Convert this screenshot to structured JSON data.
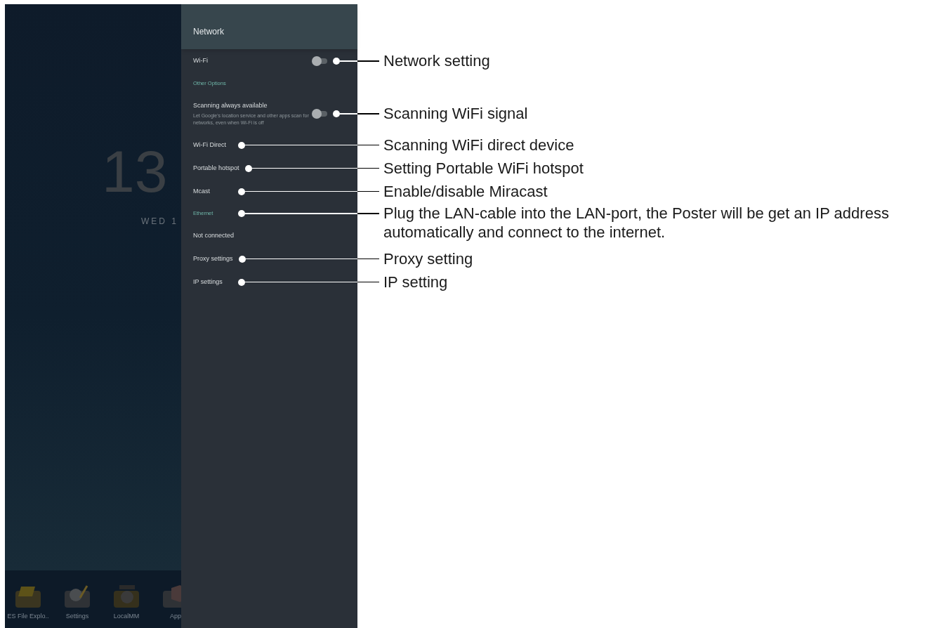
{
  "home_screen": {
    "clock": "13",
    "date": "WED 1",
    "dock": [
      {
        "label": "ES File Explo.."
      },
      {
        "label": "Settings"
      },
      {
        "label": "LocalMM"
      },
      {
        "label": "App"
      }
    ]
  },
  "panel": {
    "title": "Network",
    "items": [
      {
        "kind": "toggle",
        "label": "Wi-Fi",
        "on": false,
        "callout": "Network setting"
      },
      {
        "kind": "header",
        "label": "Other Options"
      },
      {
        "kind": "toggle",
        "label": "Scanning always available",
        "subtitle": "Let Google's location service and other apps scan for networks, even when Wi-Fi is off",
        "on": false,
        "callout": "Scanning WiFi signal"
      },
      {
        "kind": "item",
        "label": "Wi-Fi Direct",
        "callout": "Scanning WiFi direct device"
      },
      {
        "kind": "item",
        "label": "Portable hotspot",
        "callout": "Setting Portable WiFi hotspot"
      },
      {
        "kind": "item",
        "label": "Mcast",
        "callout": "Enable/disable Miracast"
      },
      {
        "kind": "header",
        "label": "Ethernet",
        "callout": "Plug the LAN-cable into the LAN-port, the Poster will be get an IP address automatically and connect to the internet."
      },
      {
        "kind": "item",
        "label": "Not connected"
      },
      {
        "kind": "item",
        "label": "Proxy settings",
        "callout": "Proxy setting"
      },
      {
        "kind": "item",
        "label": "IP settings",
        "callout": "IP setting"
      }
    ]
  }
}
